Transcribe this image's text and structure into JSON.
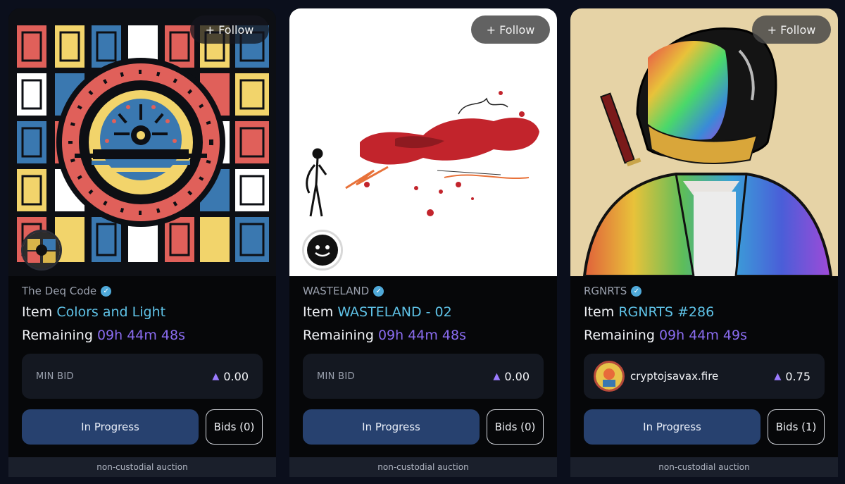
{
  "cards": [
    {
      "follow_label": "+ Follow",
      "collection": "The Deq Code",
      "item_prefix": "Item",
      "item_name": "Colors and Light",
      "remaining_prefix": "Remaining",
      "remaining_value": "09h 44m 48s",
      "bid_label": "MIN BID",
      "bid_amount": "0.00",
      "progress_label": "In Progress",
      "bids_label": "Bids (0)",
      "footer": "non-custodial auction"
    },
    {
      "follow_label": "+ Follow",
      "collection": "WASTELAND",
      "item_prefix": "Item",
      "item_name": "WASTELAND - 02",
      "remaining_prefix": "Remaining",
      "remaining_value": "09h 44m 48s",
      "bid_label": "MIN BID",
      "bid_amount": "0.00",
      "progress_label": "In Progress",
      "bids_label": "Bids (0)",
      "footer": "non-custodial auction"
    },
    {
      "follow_label": "+ Follow",
      "collection": "RGNRTS",
      "item_prefix": "Item",
      "item_name": "RGNRTS #286",
      "remaining_prefix": "Remaining",
      "remaining_value": "09h 44m 49s",
      "bidder_name": "cryptojsavax.fire",
      "bid_amount": "0.75",
      "progress_label": "In Progress",
      "bids_label": "Bids (1)",
      "footer": "non-custodial auction"
    }
  ],
  "colors": {
    "card_bg": "#060709",
    "item_name": "#5fc3e8",
    "remaining": "#8a6cf0",
    "progress_button": "#27416f",
    "verified": "#4fa9d9",
    "avax": "#9b7bff"
  },
  "icons": {
    "verified": "verified-badge-icon",
    "currency": "avax-triangle-icon"
  }
}
